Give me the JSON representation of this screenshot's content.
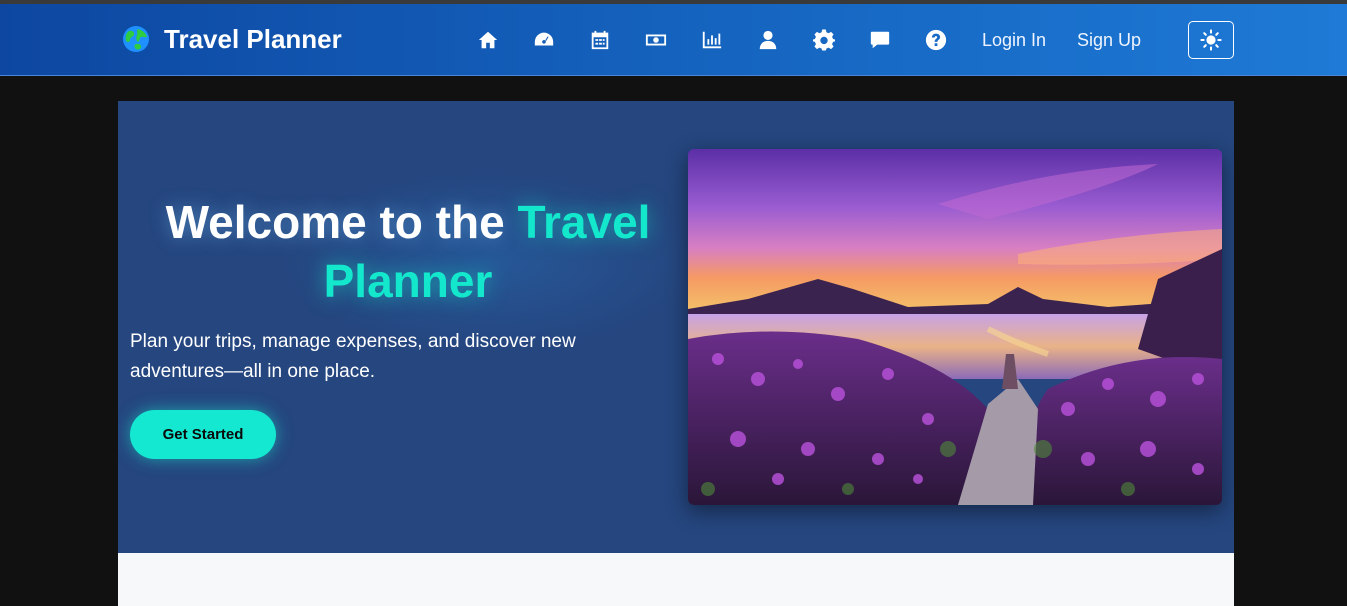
{
  "brand": {
    "name": "Travel Planner",
    "logo_icon": "globe-icon"
  },
  "nav": {
    "icons": [
      {
        "name": "home-icon"
      },
      {
        "name": "dashboard-icon"
      },
      {
        "name": "calendar-icon"
      },
      {
        "name": "money-icon"
      },
      {
        "name": "chart-icon"
      },
      {
        "name": "user-icon"
      },
      {
        "name": "gear-icon"
      },
      {
        "name": "chat-icon"
      },
      {
        "name": "help-icon"
      }
    ],
    "login_label": "Login In",
    "signup_label": "Sign Up",
    "theme_toggle_icon": "sun-icon"
  },
  "hero": {
    "title_plain": "Welcome to the ",
    "title_accent": "Travel Planner",
    "subtitle": "Plan your trips, manage expenses, and discover new adventures—all in one place.",
    "cta_label": "Get Started",
    "image_icon": "lake-landscape-image"
  },
  "colors": {
    "navbar_start": "#0d47a1",
    "navbar_end": "#1e7ad6",
    "hero_bg": "#25467f",
    "accent": "#14e8cc",
    "page_bg": "#111111"
  }
}
